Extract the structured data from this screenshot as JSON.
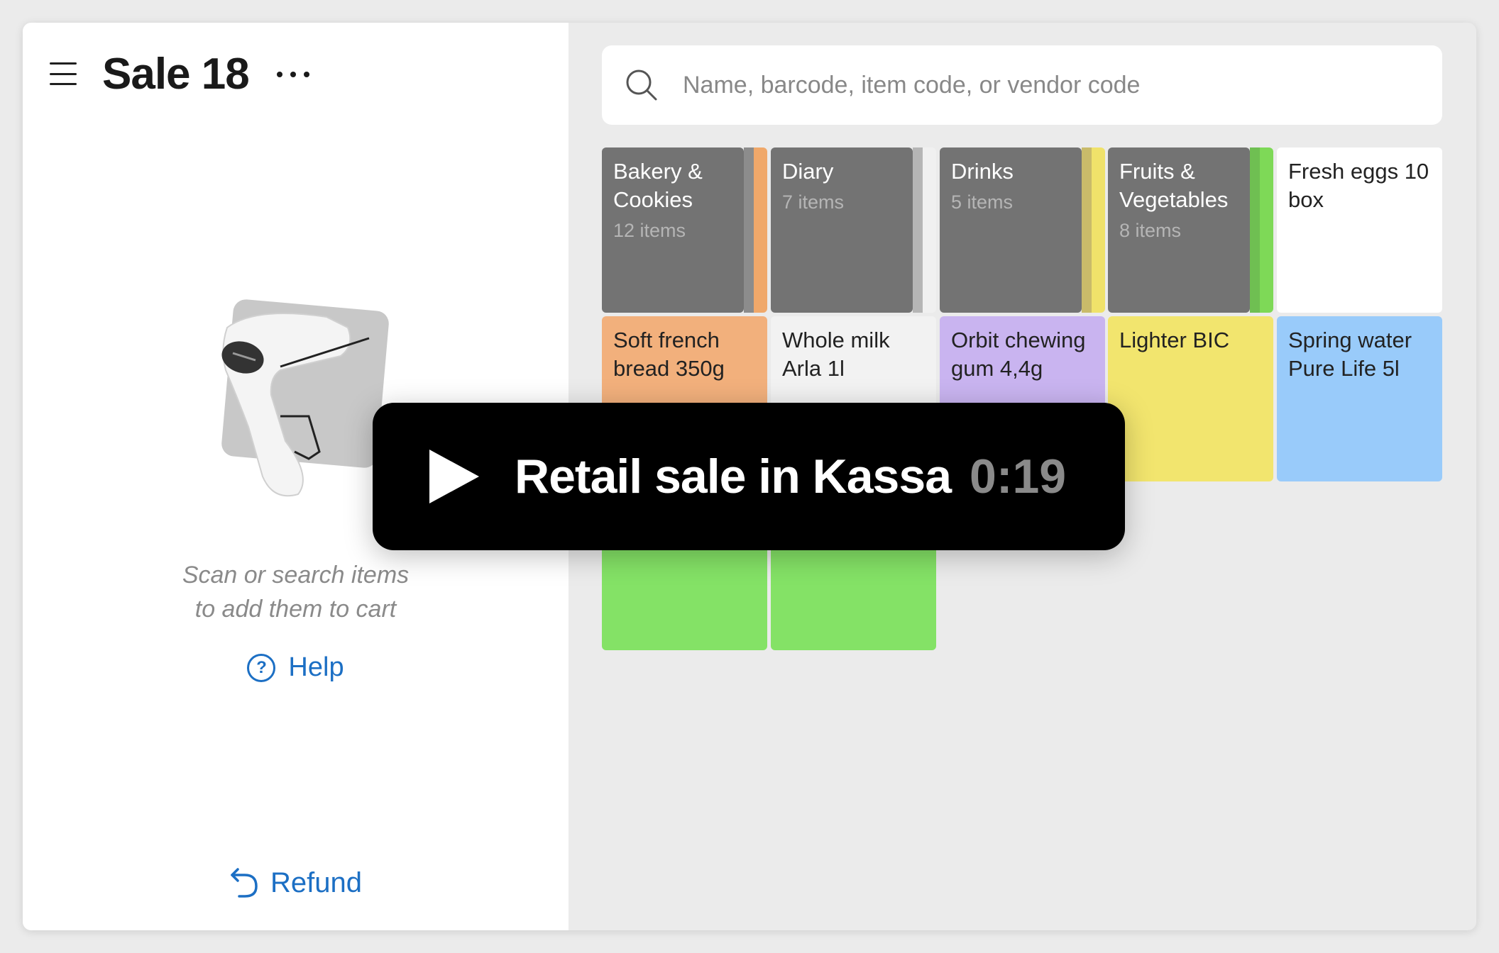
{
  "header": {
    "title": "Sale 18"
  },
  "empty_state": {
    "line1": "Scan or search items",
    "line2": "to add them to cart",
    "help_label": "Help",
    "help_glyph": "?"
  },
  "footer": {
    "refund_label": "Refund"
  },
  "search": {
    "placeholder": "Name, barcode, item code, or vendor code"
  },
  "folders": [
    {
      "name": "Bakery & Cookies",
      "count": "12 items",
      "accent": "#f0a86a"
    },
    {
      "name": "Diary",
      "count": "7 items",
      "accent": "#d8d8d8"
    },
    {
      "name": "Drinks",
      "count": "5 items",
      "accent": "#f0e26a"
    },
    {
      "name": "Fruits & Vegetables",
      "count": "8 items",
      "accent": "#7ed957"
    }
  ],
  "items": [
    {
      "name": "Fresh eggs 10 box",
      "color": "#ffffff"
    },
    {
      "name": "Soft french bread 350g",
      "color": "#f2b07c"
    },
    {
      "name": "Whole milk Arla 1l",
      "color": "#f2f2f2"
    },
    {
      "name": "Orbit chewing gum 4,4g",
      "color": "#c9b4f0"
    },
    {
      "name": "Lighter BIC",
      "color": "#f2e56e"
    },
    {
      "name": "Spring water Pure Life 5l",
      "color": "#99cbfa"
    },
    {
      "name": "",
      "color": "#84e266"
    },
    {
      "name": "",
      "color": "#84e266"
    }
  ],
  "video": {
    "title": "Retail sale in Kassa",
    "duration": "0:19"
  },
  "colors": {
    "accent_link": "#1c6fc4",
    "folder_gray": "#737373"
  }
}
